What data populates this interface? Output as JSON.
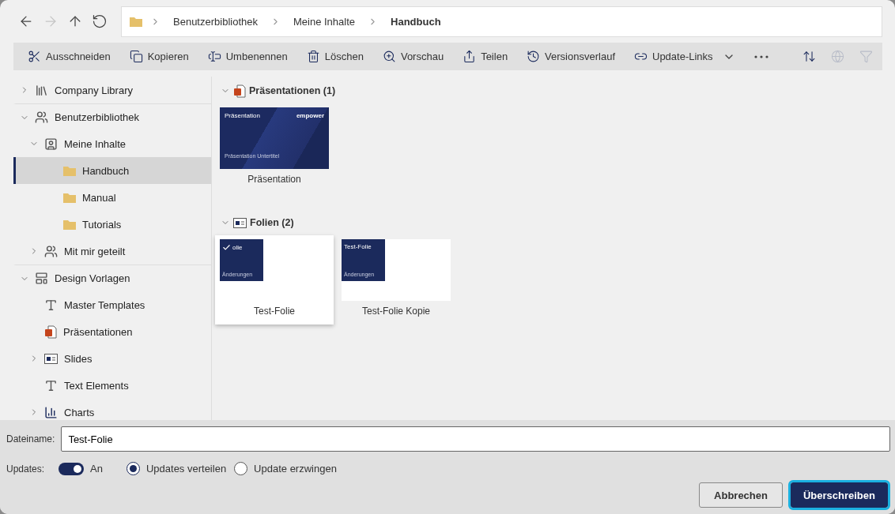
{
  "nav": [
    {
      "kind": "back",
      "disabled": false
    },
    {
      "kind": "forward",
      "disabled": true
    },
    {
      "kind": "up",
      "disabled": false
    },
    {
      "kind": "refresh",
      "disabled": false
    }
  ],
  "breadcrumb": [
    "Benutzerbibliothek",
    "Meine Inhalte",
    "Handbuch"
  ],
  "toolbar": {
    "actions": [
      {
        "kind": "cut",
        "label": "Ausschneiden"
      },
      {
        "kind": "copy",
        "label": "Kopieren"
      },
      {
        "kind": "rename",
        "label": "Umbenennen"
      },
      {
        "kind": "delete",
        "label": "Löschen"
      },
      {
        "kind": "preview",
        "label": "Vorschau"
      },
      {
        "kind": "share",
        "label": "Teilen"
      },
      {
        "kind": "history",
        "label": "Versionsverlauf"
      },
      {
        "kind": "links",
        "label": "Update-Links"
      },
      {
        "kind": "more"
      }
    ],
    "tools": [
      {
        "kind": "sort",
        "disabled": false
      },
      {
        "kind": "globe",
        "disabled": true
      },
      {
        "kind": "filter",
        "disabled": true
      }
    ]
  },
  "tree": [
    {
      "kind": "library",
      "label": "Company Library",
      "expanded": false
    },
    {
      "kind": "user-library",
      "label": "Benutzerbibliothek",
      "expanded": true,
      "children": [
        {
          "kind": "user-folder",
          "label": "Meine Inhalte",
          "expanded": true,
          "children": [
            {
              "kind": "folder",
              "label": "Handbuch",
              "selected": true
            },
            {
              "kind": "folder",
              "label": "Manual",
              "selected": false
            },
            {
              "kind": "folder",
              "label": "Tutorials",
              "selected": false
            }
          ]
        },
        {
          "kind": "shared",
          "label": "Mit mir geteilt",
          "expanded": false
        }
      ]
    },
    {
      "kind": "design",
      "label": "Design Vorlagen",
      "expanded": true,
      "children": [
        {
          "kind": "template",
          "label": "Master Templates"
        },
        {
          "kind": "ppt",
          "label": "Präsentationen"
        },
        {
          "kind": "slides",
          "label": "Slides",
          "expanded": false
        },
        {
          "kind": "text",
          "label": "Text Elements"
        },
        {
          "kind": "chart",
          "label": "Charts",
          "expanded": false
        }
      ]
    }
  ],
  "groups": [
    {
      "kind": "ppt",
      "title": "Präsentationen (1)",
      "expanded": true,
      "items": [
        {
          "name": "Präsentation",
          "selected": false,
          "thumbnail": {
            "kind": "deck",
            "title": "Präsentation",
            "logo": "empower",
            "subtitle": "Präsentation Untertitel"
          }
        }
      ]
    },
    {
      "kind": "slides",
      "title": "Folien (2)",
      "expanded": true,
      "items": [
        {
          "name": "Test-Folie",
          "selected": true,
          "thumbnail": {
            "kind": "slide",
            "title": "olie",
            "footer": "Änderungen"
          }
        },
        {
          "name": "Test-Folie Kopie",
          "selected": false,
          "thumbnail": {
            "kind": "slide",
            "title": "Test-Folie",
            "footer": "Änderungen"
          }
        }
      ]
    }
  ],
  "filename": {
    "label": "Dateiname:",
    "value": "Test-Folie"
  },
  "updates": {
    "label": "Updates:",
    "on": true,
    "state_label": "An",
    "options": [
      {
        "label": "Updates verteilen",
        "selected": true
      },
      {
        "label": "Update erzwingen",
        "selected": false
      }
    ]
  },
  "buttons": [
    {
      "label": "Abbrechen",
      "primary": false
    },
    {
      "label": "Überschreiben",
      "primary": true
    }
  ]
}
